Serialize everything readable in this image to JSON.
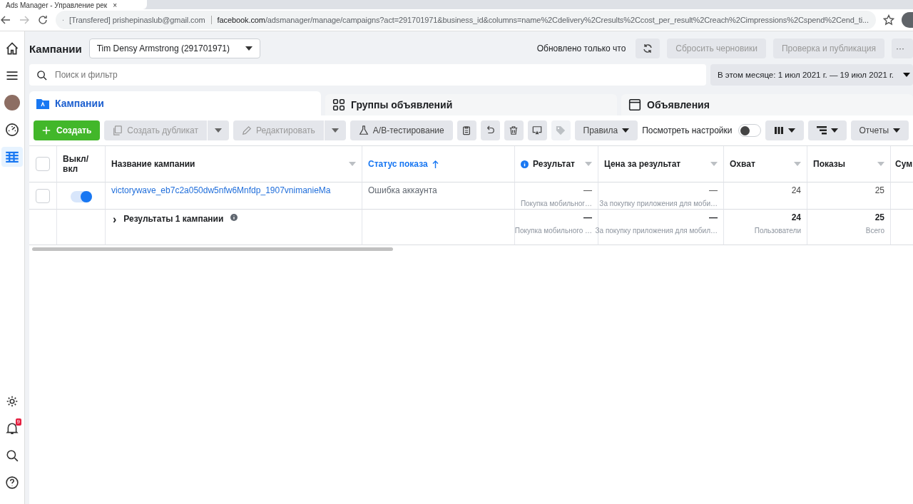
{
  "browser": {
    "tab_title": "Ads Manager - Управление рек",
    "close": "×",
    "account_label": "[Transfered] prishepinaslub@gmail.com",
    "url_host": "facebook.com",
    "url_path": "/adsmanager/manage/campaigns?act=291701971&business_id&columns=name%2Cdelivery%2Cresults%2Ccost_per_result%2Creach%2Cimpressions%2Cspend%2Cend_ti..."
  },
  "sidebar": {
    "items": [
      {
        "selected": false
      },
      {
        "selected": false
      },
      {
        "selected": false
      },
      {
        "selected": false
      },
      {
        "selected": true
      }
    ],
    "notification_badge": "9"
  },
  "header": {
    "title": "Кампании",
    "account": "Tim Densy Armstrong (291701971)",
    "updated": "Обновлено только что",
    "buttons": [
      {
        "label": "Сбросить черновики",
        "disabled": true
      },
      {
        "label": "Проверка и публикация",
        "disabled": true
      }
    ],
    "more": "···"
  },
  "search": {
    "placeholder": "Поиск и фильтр"
  },
  "date_range": "В этом месяце: 1 июл 2021 г. — 19 июл 2021 г.",
  "level_tabs": [
    {
      "label": "Кампании",
      "selected": true
    },
    {
      "label": "Группы объявлений",
      "selected": false
    },
    {
      "label": "Объявления",
      "selected": false
    }
  ],
  "toolbar": {
    "create": "Создать",
    "duplicate": {
      "label": "Создать дубликат",
      "disabled": true
    },
    "edit": {
      "label": "Редактировать",
      "disabled": true
    },
    "ab_test": "A/B-тестирование",
    "icon_buttons": [
      {
        "disabled": false
      },
      {
        "disabled": false
      },
      {
        "disabled": false
      },
      {
        "disabled": false
      },
      {
        "disabled": true
      }
    ],
    "rules": "Правила",
    "view_settings": {
      "label": "Посмотреть настройки",
      "on": false
    },
    "reports": "Отчеты"
  },
  "table": {
    "header_checkbox": {
      "checked": false
    },
    "columns": [
      {
        "label": "Выкл/ вкл",
        "sorted": false,
        "info": false
      },
      {
        "label": "Название кампании",
        "sorted": false,
        "info": false
      },
      {
        "label": "Статус показа",
        "sorted": true,
        "info": false
      },
      {
        "label": "Результат",
        "sorted": false,
        "info": true
      },
      {
        "label": "Цена за результат",
        "sorted": false,
        "info": false
      },
      {
        "label": "Охват",
        "sorted": false,
        "info": false
      },
      {
        "label": "Показы",
        "sorted": false,
        "info": false
      },
      {
        "label": "Сум",
        "sorted": false,
        "info": false
      }
    ],
    "rows": [
      {
        "checked": false,
        "on": true,
        "name": "victorywave_eb7c2a050dw5nfw6Mnfdp_1907vnimanieMa",
        "status": "Ошибка аккаунта",
        "metrics": [
          {
            "value": "—",
            "sub": "Покупка мобильног…"
          },
          {
            "value": "—",
            "sub": "За покупку приложения для моби…"
          },
          {
            "value": "24"
          },
          {
            "value": "25"
          }
        ]
      }
    ],
    "totals": {
      "expand": "›",
      "label": "Результаты 1 кампании",
      "metrics": [
        {
          "value": "—",
          "sub": "Покупка мобильного …"
        },
        {
          "value": "—",
          "sub": "За покупку приложения для мобил…"
        },
        {
          "value": "24",
          "sub": "Пользователи"
        },
        {
          "value": "25",
          "sub": "Всего"
        }
      ]
    }
  }
}
